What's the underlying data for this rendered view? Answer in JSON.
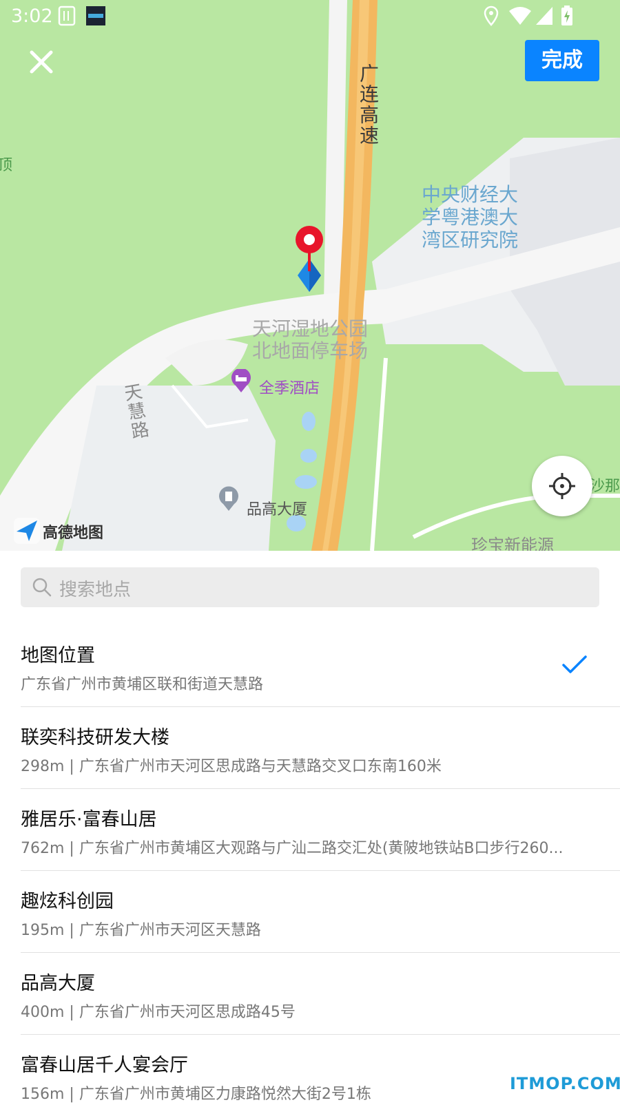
{
  "status_bar": {
    "time": "3:02",
    "icons": [
      "sim-card-icon",
      "screen-thumbnail-icon",
      "location-icon",
      "wifi-icon",
      "signal-icon",
      "battery-charging-icon"
    ]
  },
  "header": {
    "close_icon": "close-icon",
    "done_label": "完成"
  },
  "map": {
    "road_name": "广连高速",
    "institute_label": "中央财经大学粤港澳大湾区研究院",
    "park_label_line1": "天河湿地公园",
    "park_label_line2": "北地面停车场",
    "hotel_label": "全季酒店",
    "street_label": "天慧路",
    "building_label": "品高大厦",
    "edge_left_label": "顶",
    "edge_right_label": "沙那",
    "bottom_label": "珍宝新能源",
    "brand_name": "高德地图",
    "locate_icon": "crosshair-icon",
    "pin_icon": "map-pin-icon",
    "colors": {
      "grass": "#b9e7a2",
      "road": "#f6f6f6",
      "highway": "#f3b75f",
      "water": "#a9d3f5",
      "pin": "#e8152b",
      "arrow": "#1e88e5"
    }
  },
  "search": {
    "placeholder": "搜索地点",
    "icon": "search-icon"
  },
  "results": [
    {
      "title": "地图位置",
      "subtitle": "广东省广州市黄埔区联和街道天慧路",
      "selected": true
    },
    {
      "title": "联奕科技研发大楼",
      "subtitle": "298m | 广东省广州市天河区思成路与天慧路交叉口东南160米",
      "selected": false
    },
    {
      "title": "雅居乐·富春山居",
      "subtitle": "762m | 广东省广州市黄埔区大观路与广汕二路交汇处(黄陂地铁站B口步行260...",
      "selected": false
    },
    {
      "title": "趣炫科创园",
      "subtitle": "195m | 广东省广州市天河区天慧路",
      "selected": false
    },
    {
      "title": "品高大厦",
      "subtitle": "400m | 广东省广州市天河区思成路45号",
      "selected": false
    },
    {
      "title": "富春山居千人宴会厅",
      "subtitle": "156m | 广东省广州市黄埔区力康路悦然大街2号1栋",
      "selected": false
    }
  ],
  "watermark": "ITMOP.COM",
  "accent_color": "#0a84ff"
}
